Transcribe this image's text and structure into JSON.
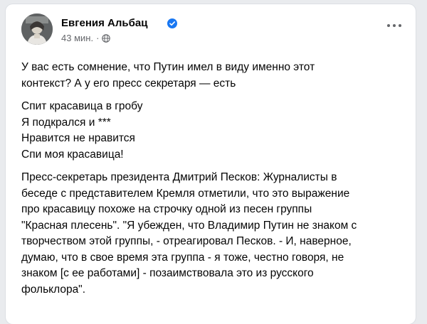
{
  "post": {
    "author": {
      "name": "Евгения Альбац",
      "verified": true
    },
    "timestamp": "43 мин.",
    "separator": "·",
    "audience_icon": "globe-icon",
    "more_icon": "more-options-icon",
    "intro": [
      "У вас есть сомнение, что Путин имел в виду именно этот",
      "контекст?   А у его пресс секретаря — есть"
    ],
    "verse": [
      "Спит красавица в гробу",
      "Я подкрался и ***",
      "Нравится не нравится",
      "Спи моя красавица!"
    ],
    "quote": [
      "Пресс-секретарь президента Дмитрий Песков: Журналисты в",
      "беседе с представителем Кремля отметили, что это выражение",
      "про красавицу похоже на строчку одной из песен группы",
      "\"Красная плесень\". \"Я убежден, что Владимир Путин не знаком с",
      "творчеством этой группы, - отреагировал Песков. - И, наверное,",
      "думаю, что в свое время эта группа - я тоже, честно говоря, не",
      "знаком [с ее работами] - позаимствовала это из русского",
      "фольклора\"."
    ],
    "colors": {
      "text": "#050505",
      "secondary": "#65676b",
      "verified_badge": "#1877f2",
      "background": "#e9ebee"
    }
  }
}
